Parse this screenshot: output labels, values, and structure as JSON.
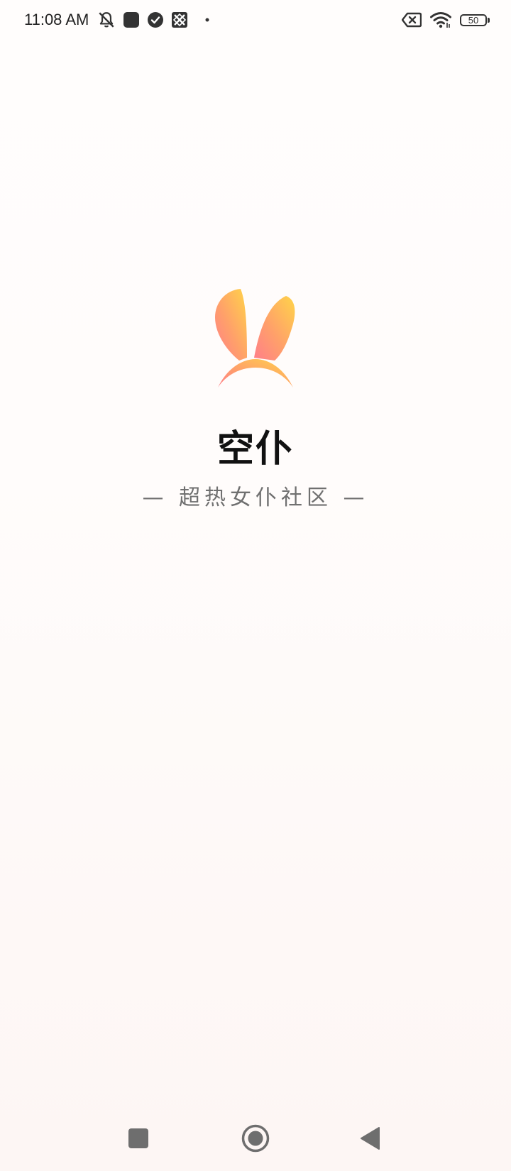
{
  "status_bar": {
    "time": "11:08 AM",
    "battery_level": "50",
    "icons": [
      "bell-off-icon",
      "app-square-icon",
      "check-circle-icon",
      "sim-blocked-icon",
      "dot-icon",
      "no-sim-icon",
      "wifi-icon",
      "battery-icon"
    ]
  },
  "splash": {
    "app_name": "空仆",
    "tagline": "— 超热女仆社区 —",
    "logo": "bunny-ears-icon",
    "logo_gradient": [
      "#ffd449",
      "#ff7e8a"
    ]
  },
  "nav_bar": {
    "icons": [
      "recents-square-icon",
      "home-circle-icon",
      "back-triangle-icon"
    ]
  },
  "colors": {
    "background": "#fffcfb",
    "title": "#111111",
    "tagline": "#707070",
    "nav_icon": "#6e6e6e"
  }
}
